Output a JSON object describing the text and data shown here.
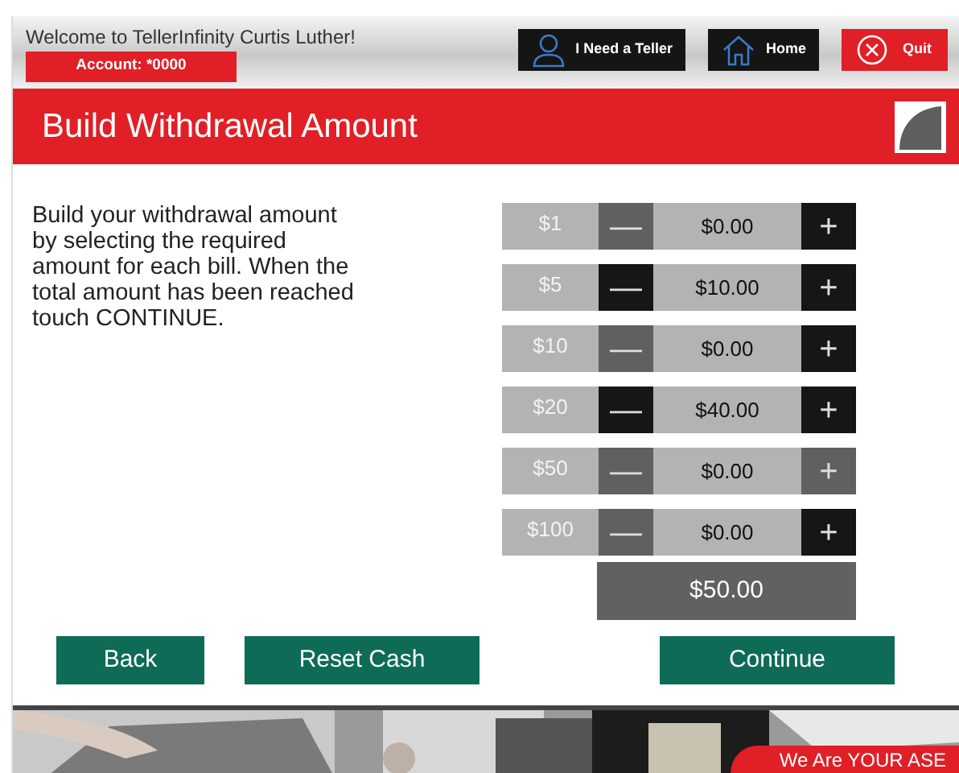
{
  "header": {
    "welcome": "Welcome to TellerInfinity Curtis Luther!",
    "account": "Account: *0000",
    "buttons": [
      {
        "kind": "teller",
        "label": "I Need a Teller"
      },
      {
        "kind": "home",
        "label": "Home"
      },
      {
        "kind": "quit",
        "label": "Quit"
      }
    ]
  },
  "title": "Build Withdrawal Amount",
  "instructions": "Build your withdrawal amount by selecting the required amount for each bill. When the total amount has been reached touch CONTINUE.",
  "bills": [
    {
      "denomination": "$1",
      "minus": "—",
      "amount": "$0.00",
      "plus": "+",
      "minus_disabled": true,
      "plus_disabled": false
    },
    {
      "denomination": "$5",
      "minus": "—",
      "amount": "$10.00",
      "plus": "+",
      "minus_disabled": false,
      "plus_disabled": false
    },
    {
      "denomination": "$10",
      "minus": "—",
      "amount": "$0.00",
      "plus": "+",
      "minus_disabled": true,
      "plus_disabled": false
    },
    {
      "denomination": "$20",
      "minus": "—",
      "amount": "$40.00",
      "plus": "+",
      "minus_disabled": false,
      "plus_disabled": false
    },
    {
      "denomination": "$50",
      "minus": "—",
      "amount": "$0.00",
      "plus": "+",
      "minus_disabled": true,
      "plus_disabled": true
    },
    {
      "denomination": "$100",
      "minus": "—",
      "amount": "$0.00",
      "plus": "+",
      "minus_disabled": true,
      "plus_disabled": false
    }
  ],
  "total": "$50.00",
  "actions": [
    {
      "label": "Back"
    },
    {
      "label": "Reset Cash"
    },
    {
      "label": "Continue"
    }
  ],
  "footer": {
    "banner": "We Are YOUR ASE"
  }
}
